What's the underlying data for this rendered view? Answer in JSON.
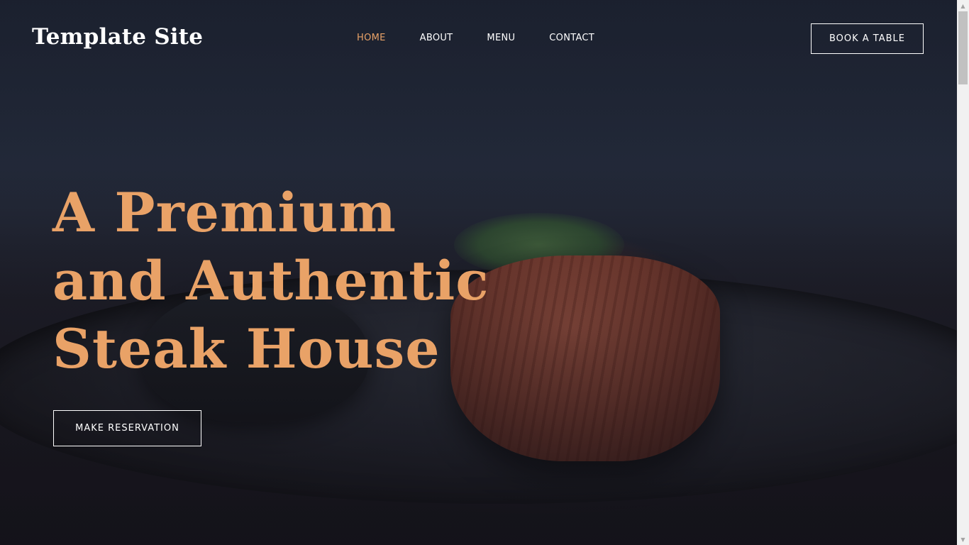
{
  "header": {
    "brand": "Template Site",
    "nav": [
      {
        "label": "HOME",
        "active": true
      },
      {
        "label": "ABOUT",
        "active": false
      },
      {
        "label": "MENU",
        "active": false
      },
      {
        "label": "CONTACT",
        "active": false
      }
    ],
    "cta_label": "BOOK A TABLE"
  },
  "hero": {
    "title_lines": [
      "A Premium",
      "and Authentic",
      "Steak House"
    ],
    "button_label": "MAKE RESERVATION",
    "background_image": "steak-on-plate-image"
  },
  "scrollbar": {
    "up_icon": "scroll-up-arrow-icon",
    "down_icon": "scroll-down-arrow-icon"
  },
  "colors": {
    "accent": "#e9a267",
    "text": "#ffffff",
    "background": "#1d2230"
  }
}
